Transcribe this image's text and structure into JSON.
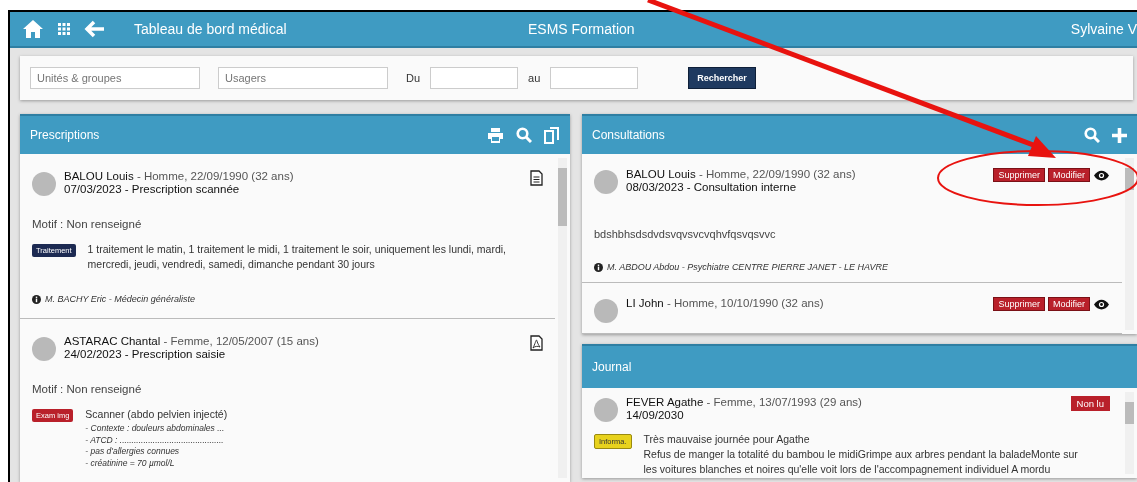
{
  "header": {
    "title": "Tableau de bord médical",
    "organization": "ESMS Formation",
    "user": "Sylvaine V"
  },
  "filters": {
    "fields": [
      {
        "placeholder": "Unités & groupes"
      },
      {
        "placeholder": "Usagers"
      }
    ],
    "from_label": "Du",
    "to_label": "au",
    "search_button": "Rechercher"
  },
  "prescriptions": {
    "title": "Prescriptions",
    "items": [
      {
        "name": "BALOU Louis",
        "info": " - Homme, 22/09/1990 (32 ans)",
        "date_line": "07/03/2023 - Prescription scannée",
        "kind": "text",
        "motif": "Motif : Non renseigné",
        "tag": {
          "label": "Traitement",
          "kind": "treatment"
        },
        "text": "1 traitement le matin, 1 traitement le midi, 1 traitement le soir, uniquement les lundi, mardi, mercredi, jeudi, vendredi, samedi, dimanche pendant 30 jours",
        "author": "M. BACHY Eric - Médecin généraliste"
      },
      {
        "name": "ASTARAC Chantal",
        "info": " - Femme, 12/05/2007 (15 ans)",
        "date_line": "24/02/2023 - Prescription saisie",
        "kind": "pdf",
        "motif": "Motif : Non renseigné",
        "tag": {
          "label": "Exam img",
          "kind": "exam"
        },
        "text": "Scanner (abdo pelvien injecté)",
        "details": [
          "- Contexte : douleurs abdominales ...",
          "- ATCD : ............................................",
          "- pas d'allergies connues",
          "- créatinine = 70 µmol/L"
        ]
      }
    ]
  },
  "consultations": {
    "title": "Consultations",
    "items": [
      {
        "name": "BALOU Louis",
        "info": " - Homme, 22/09/1990 (32 ans)",
        "date_line": "08/03/2023 - Consultation interne",
        "text": "bdshbhsdsdvdsvqvsvcvqhvfqsvqsvvc",
        "author": "M. ABDOU Abdou - Psychiatre CENTRE PIERRE JANET - LE HAVRE",
        "actions": [
          "Supprimer",
          "Modifier"
        ]
      },
      {
        "name": "LI John",
        "info": " - Homme, 10/10/1990 (32 ans)",
        "actions": [
          "Supprimer",
          "Modifier"
        ]
      }
    ]
  },
  "journal": {
    "title": "Journal",
    "items": [
      {
        "name": "FEVER Agathe",
        "info": " - Femme, 13/07/1993 (29 ans)",
        "date": "14/09/2030",
        "status": "Non lu",
        "tag": {
          "label": "Informa.",
          "kind": "info"
        },
        "lines": [
          "Très mauvaise journée pour Agathe",
          "Refus de manger la totalité du bambou le midiGrimpe aux arbres pendant la baladeMonte sur",
          "les voitures blanches et noires qu'elle voit lors de l'accompagnement individuel A mordu"
        ]
      }
    ]
  }
}
